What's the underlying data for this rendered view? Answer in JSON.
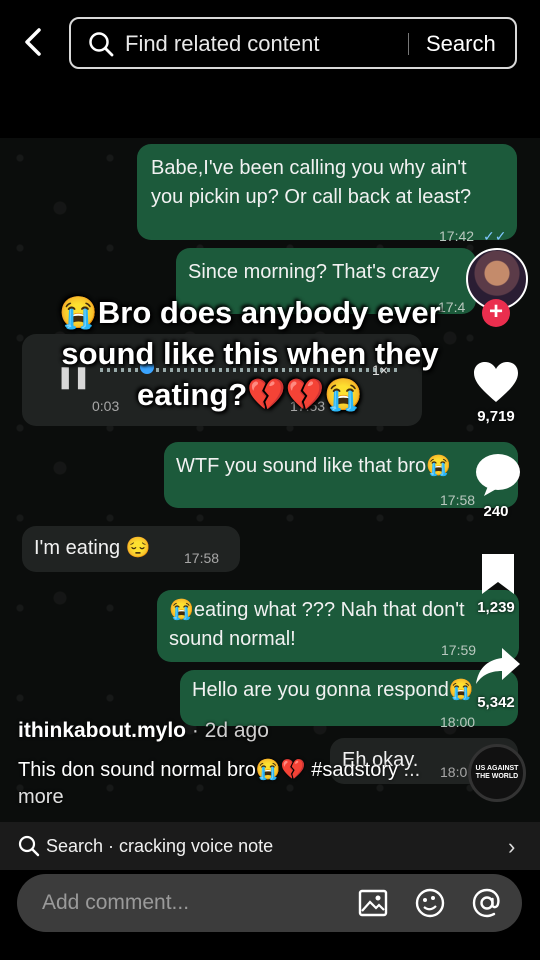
{
  "search": {
    "placeholder": "Find related content",
    "button": "Search"
  },
  "chat": {
    "messages": [
      {
        "text": "Babe,I've been calling you why ain't you pickin up? Or call back at least?",
        "time": "17:42",
        "dir": "out"
      },
      {
        "text": "Since morning? That's crazy",
        "time": "17:4",
        "dir": "out"
      },
      {
        "text": "WTF you sound like that bro😭",
        "time": "17:58",
        "dir": "out"
      },
      {
        "text": "I'm eating 😔",
        "time": "17:58",
        "dir": "in"
      },
      {
        "text": "😭eating what ??? Nah that don't sound normal!",
        "time": "17:59",
        "dir": "out"
      },
      {
        "text": "Hello are you gonna respond😭",
        "time": "18:00",
        "dir": "out"
      },
      {
        "text": "Eh okay.",
        "time": "18:0",
        "dir": "in"
      }
    ],
    "voice": {
      "duration": "0:03",
      "speed": "1×",
      "time": "17:53"
    }
  },
  "overlay_caption": "😭Bro does anybody ever sound like this when they eating?💔💔😭",
  "rail": {
    "likes": "9,719",
    "comments": "240",
    "saves": "1,239",
    "shares": "5,342",
    "disc_text": "US AGAINST THE WORLD"
  },
  "post": {
    "author": "ithinkabout.mylo",
    "ago": " · 2d ago",
    "description": "This don sound normal bro😭💔 #sadstory",
    "more": " ... more"
  },
  "related": {
    "label": "Search · cracking voice note"
  },
  "comment": {
    "placeholder": "Add comment..."
  },
  "colors": {
    "outgoing_bubble": "#1c5a3b",
    "incoming_bubble": "#202322",
    "follow_badge": "#ea2e4e"
  }
}
